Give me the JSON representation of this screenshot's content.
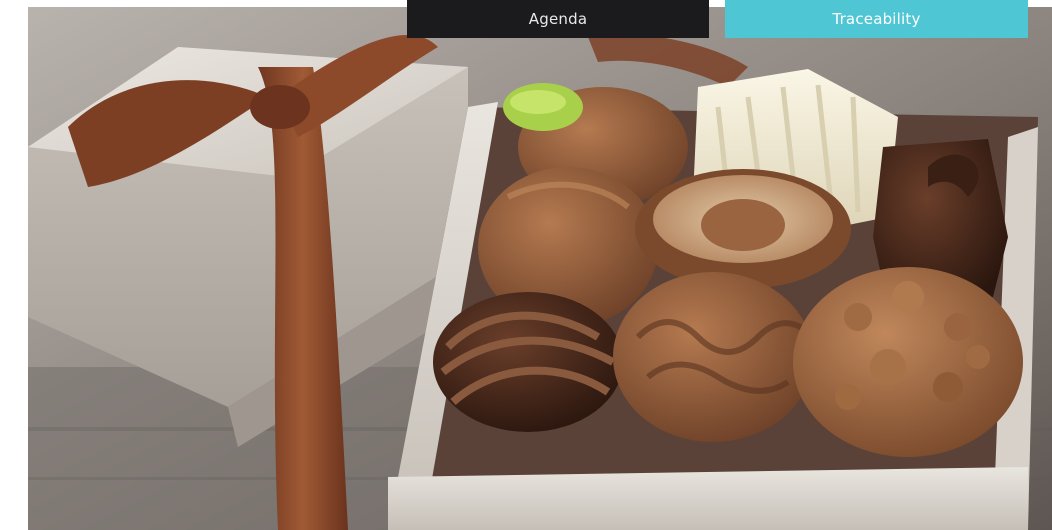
{
  "nav": {
    "tabs": [
      {
        "label": "Agenda",
        "state": "default"
      },
      {
        "label": "Traceability",
        "state": "active"
      }
    ]
  },
  "hero_image": {
    "subject": "box-of-chocolates",
    "palette": {
      "tab_dark": "#1b1b1d",
      "tab_accent": "#4fc6d4",
      "ribbon": "#8a4a2c",
      "gift_box": "#dcd7d0",
      "chocolate_dark": "#3a2218",
      "chocolate_milk": "#8b5a3a",
      "chocolate_white": "#efe8d3"
    }
  }
}
